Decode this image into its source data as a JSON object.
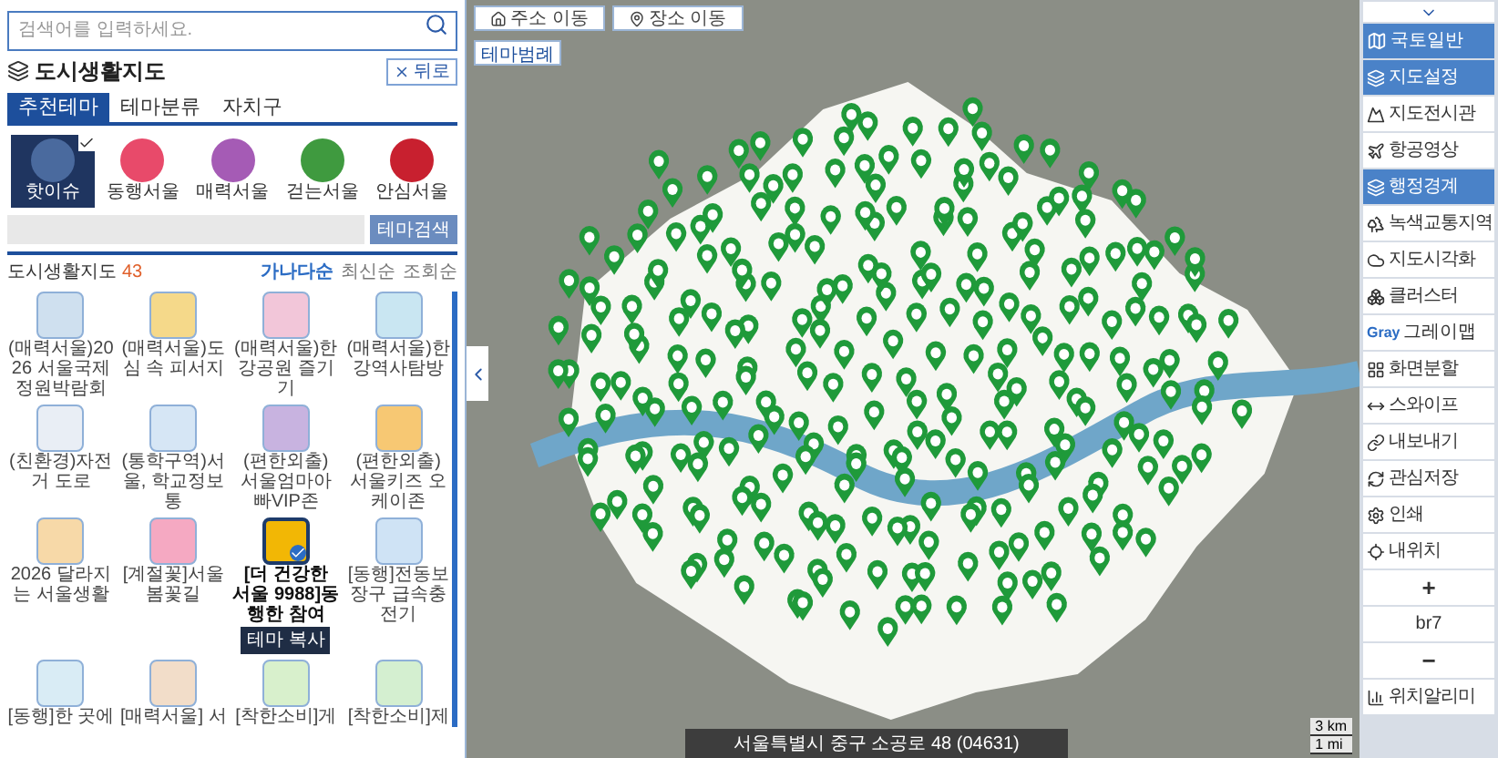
{
  "search": {
    "placeholder": "검색어를 입력하세요."
  },
  "panel": {
    "title": "도시생활지도",
    "back_button": "뒤로"
  },
  "tabs": [
    {
      "label": "추천테마",
      "selected": true
    },
    {
      "label": "테마분류",
      "selected": false
    },
    {
      "label": "자치구",
      "selected": false
    }
  ],
  "categories": [
    {
      "label": "핫이슈",
      "selected": true,
      "color": "#4a6a9e"
    },
    {
      "label": "동행서울",
      "selected": false,
      "color": "#e84a6a"
    },
    {
      "label": "매력서울",
      "selected": false,
      "color": "#a55bb5"
    },
    {
      "label": "걷는서울",
      "selected": false,
      "color": "#3f9a3f"
    },
    {
      "label": "안심서울",
      "selected": false,
      "color": "#c8202f"
    }
  ],
  "theme_search": {
    "button": "테마검색"
  },
  "list": {
    "title": "도시생활지도",
    "count": "43",
    "sort": [
      {
        "label": "가나다순",
        "selected": true
      },
      {
        "label": "최신순",
        "selected": false
      },
      {
        "label": "조회순",
        "selected": false
      }
    ]
  },
  "themes": [
    {
      "label": "(매력서울)2026 서울국제정원박람회",
      "selected": false
    },
    {
      "label": "(매력서울)도심 속 피서지",
      "selected": false
    },
    {
      "label": "(매력서울)한강공원 즐기기",
      "selected": false
    },
    {
      "label": "(매력서울)한강역사탐방",
      "selected": false
    },
    {
      "label": "(친환경)자전거 도로",
      "selected": false
    },
    {
      "label": "(통학구역)서울, 학교정보통",
      "selected": false
    },
    {
      "label": "(편한외출) 서울엄마아빠VIP존",
      "selected": false
    },
    {
      "label": "(편한외출) 서울키즈 오케이존",
      "selected": false
    },
    {
      "label": "2026 달라지는 서울생활",
      "selected": false
    },
    {
      "label": "[계절꽃]서울 봄꽃길",
      "selected": false
    },
    {
      "label": "[더 건강한 서울 9988]동행한 참여",
      "selected": true
    },
    {
      "label": "[동행]전동보장구 급속충전기",
      "selected": false
    },
    {
      "label": "[동행]한 곳에",
      "selected": false
    },
    {
      "label": "[매력서울] 서",
      "selected": false
    },
    {
      "label": "[착한소비]게",
      "selected": false
    },
    {
      "label": "[착한소비]제",
      "selected": false
    }
  ],
  "copy_button": "테마 복사",
  "map": {
    "address_button": "주소 이동",
    "place_button": "장소 이동",
    "legend_button": "테마범례",
    "address_bar": "서울특별시 중구 소공로 48 (04631)",
    "scale": [
      "3 km",
      "1 mi"
    ]
  },
  "toolbar": [
    {
      "kind": "thumb",
      "label": "국토일반",
      "selected": true
    },
    {
      "kind": "tool",
      "label": "지도설정",
      "selected": true
    },
    {
      "kind": "tool",
      "label": "지도전시관",
      "selected": false
    },
    {
      "kind": "tool",
      "label": "항공영상",
      "selected": false
    },
    {
      "kind": "tool",
      "label": "행정경계",
      "selected": true
    },
    {
      "kind": "tool",
      "label": "녹색교통지역",
      "selected": false
    },
    {
      "kind": "tool",
      "label": "지도시각화",
      "selected": false
    },
    {
      "kind": "tool",
      "label": "클러스터",
      "selected": false
    },
    {
      "kind": "gray",
      "label": "그레이맵",
      "icon_text": "Gray",
      "selected": false
    },
    {
      "kind": "tool",
      "label": "화면분할",
      "selected": false
    },
    {
      "kind": "tool",
      "label": "스와이프",
      "selected": false
    },
    {
      "kind": "tool",
      "label": "내보내기",
      "selected": false
    },
    {
      "kind": "tool",
      "label": "관심저장",
      "selected": false
    },
    {
      "kind": "tool",
      "label": "인쇄",
      "selected": false
    },
    {
      "kind": "tool",
      "label": "내위치",
      "selected": false
    },
    {
      "kind": "zoom",
      "label": "+",
      "selected": false
    },
    {
      "kind": "level",
      "label": "br7",
      "selected": false
    },
    {
      "kind": "zoom",
      "label": "−",
      "selected": false
    },
    {
      "kind": "tool",
      "label": "위치알리미",
      "selected": false
    }
  ]
}
